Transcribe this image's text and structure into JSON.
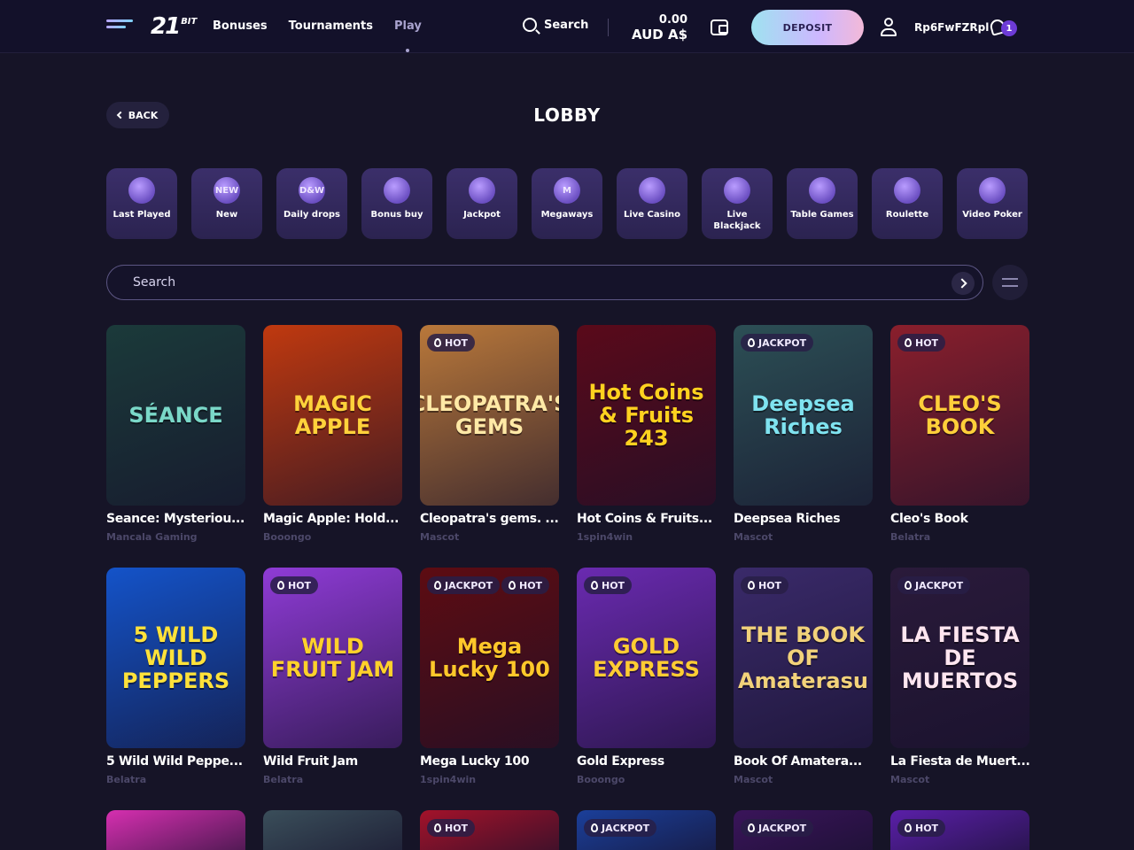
{
  "header": {
    "logo_main": "21",
    "logo_small": "BIT",
    "nav": [
      "Bonuses",
      "Tournaments",
      "Play"
    ],
    "search_label": "Search",
    "balance_amount": "0.00",
    "balance_currency": "AUD A$",
    "deposit_label": "DEPOSIT",
    "username": "Rp6FwFZRpl",
    "notifications_count": "1"
  },
  "page": {
    "back_label": "BACK",
    "title": "LOBBY"
  },
  "categories": [
    {
      "label": "Last Played",
      "icon": "play-icon"
    },
    {
      "label": "New",
      "icon": "new-badge-icon",
      "icon_text": "NEW"
    },
    {
      "label": "Daily drops",
      "icon": "daily-drops-icon",
      "icon_text": "D&W"
    },
    {
      "label": "Bonus buy",
      "icon": "gift-icon"
    },
    {
      "label": "Jackpot",
      "icon": "jackpot-icon"
    },
    {
      "label": "Megaways",
      "icon": "megaways-icon",
      "icon_text": "M"
    },
    {
      "label": "Live Casino",
      "icon": "spade-icon"
    },
    {
      "label": "Live Blackjack",
      "icon": "card-icon"
    },
    {
      "label": "Table Games",
      "icon": "table-icon"
    },
    {
      "label": "Roulette",
      "icon": "roulette-icon"
    },
    {
      "label": "Video Poker",
      "icon": "video-poker-icon"
    }
  ],
  "search": {
    "placeholder": "Search"
  },
  "games": [
    [
      {
        "name": "Seance: Mysteriou...",
        "provider": "Mancala Gaming",
        "badge": "",
        "art": "SÉANCE",
        "bg": "#1b3a3a",
        "fg": "#7ad8c8"
      },
      {
        "name": "Magic Apple: Hold...",
        "provider": "Booongo",
        "badge": "",
        "art": "MAGIC APPLE",
        "bg": "#c0390f",
        "fg": "#ffd23b"
      },
      {
        "name": "Cleopatra's gems. ...",
        "provider": "Mascot",
        "badge": "HOT",
        "art": "CLEOPATRA'S GEMS",
        "bg": "#b9783a",
        "fg": "#ffe9a6"
      },
      {
        "name": "Hot Coins & Fruits...",
        "provider": "1spin4win",
        "badge": "",
        "art": "Hot Coins & Fruits 243",
        "bg": "#5a0a1a",
        "fg": "#ffd21f"
      },
      {
        "name": "Deepsea Riches",
        "provider": "Mascot",
        "badge": "JACKPOT",
        "art": "Deepsea Riches",
        "bg": "#2c4f55",
        "fg": "#7fe3f0"
      },
      {
        "name": "Cleo's Book",
        "provider": "Belatra",
        "badge": "HOT",
        "art": "CLEO'S BOOK",
        "bg": "#8a1f2c",
        "fg": "#ffcf3a"
      }
    ],
    [
      {
        "name": "5 Wild Wild Peppe...",
        "provider": "Belatra",
        "badge": "",
        "art": "5 WILD WILD PEPPERS",
        "bg": "#1453c9",
        "fg": "#ffe23a"
      },
      {
        "name": "Wild Fruit Jam",
        "provider": "Belatra",
        "badge": "HOT",
        "art": "WILD FRUIT JAM",
        "bg": "#8f3bd6",
        "fg": "#ffd12b"
      },
      {
        "name": "Mega Lucky 100",
        "provider": "1spin4win",
        "badge": "JACKPOT",
        "badge2": "HOT",
        "art": "Mega Lucky 100",
        "bg": "#5d0c12",
        "fg": "#ffc82a"
      },
      {
        "name": "Gold Express",
        "provider": "Booongo",
        "badge": "HOT",
        "art": "GOLD EXPRESS",
        "bg": "#6a2ab0",
        "fg": "#ffcc33"
      },
      {
        "name": "Book Of Amatera...",
        "provider": "Mascot",
        "badge": "HOT",
        "art": "THE BOOK OF Amaterasu",
        "bg": "#3a2a6a",
        "fg": "#f2d27a"
      },
      {
        "name": "La Fiesta de Muert...",
        "provider": "Mascot",
        "badge": "JACKPOT",
        "art": "LA FIESTA DE MUERTOS",
        "bg": "#2a1a3a",
        "fg": "#ffe6f0"
      }
    ],
    [
      {
        "badge": "",
        "bg": "#d62fb0"
      },
      {
        "badge": "",
        "bg": "#3a4e5a"
      },
      {
        "badge": "HOT",
        "bg": "#a3122a"
      },
      {
        "badge": "JACKPOT",
        "bg": "#1b3f9a"
      },
      {
        "badge": "JACKPOT",
        "bg": "#3a145a"
      },
      {
        "badge": "HOT",
        "bg": "#5a1fa8"
      }
    ]
  ]
}
